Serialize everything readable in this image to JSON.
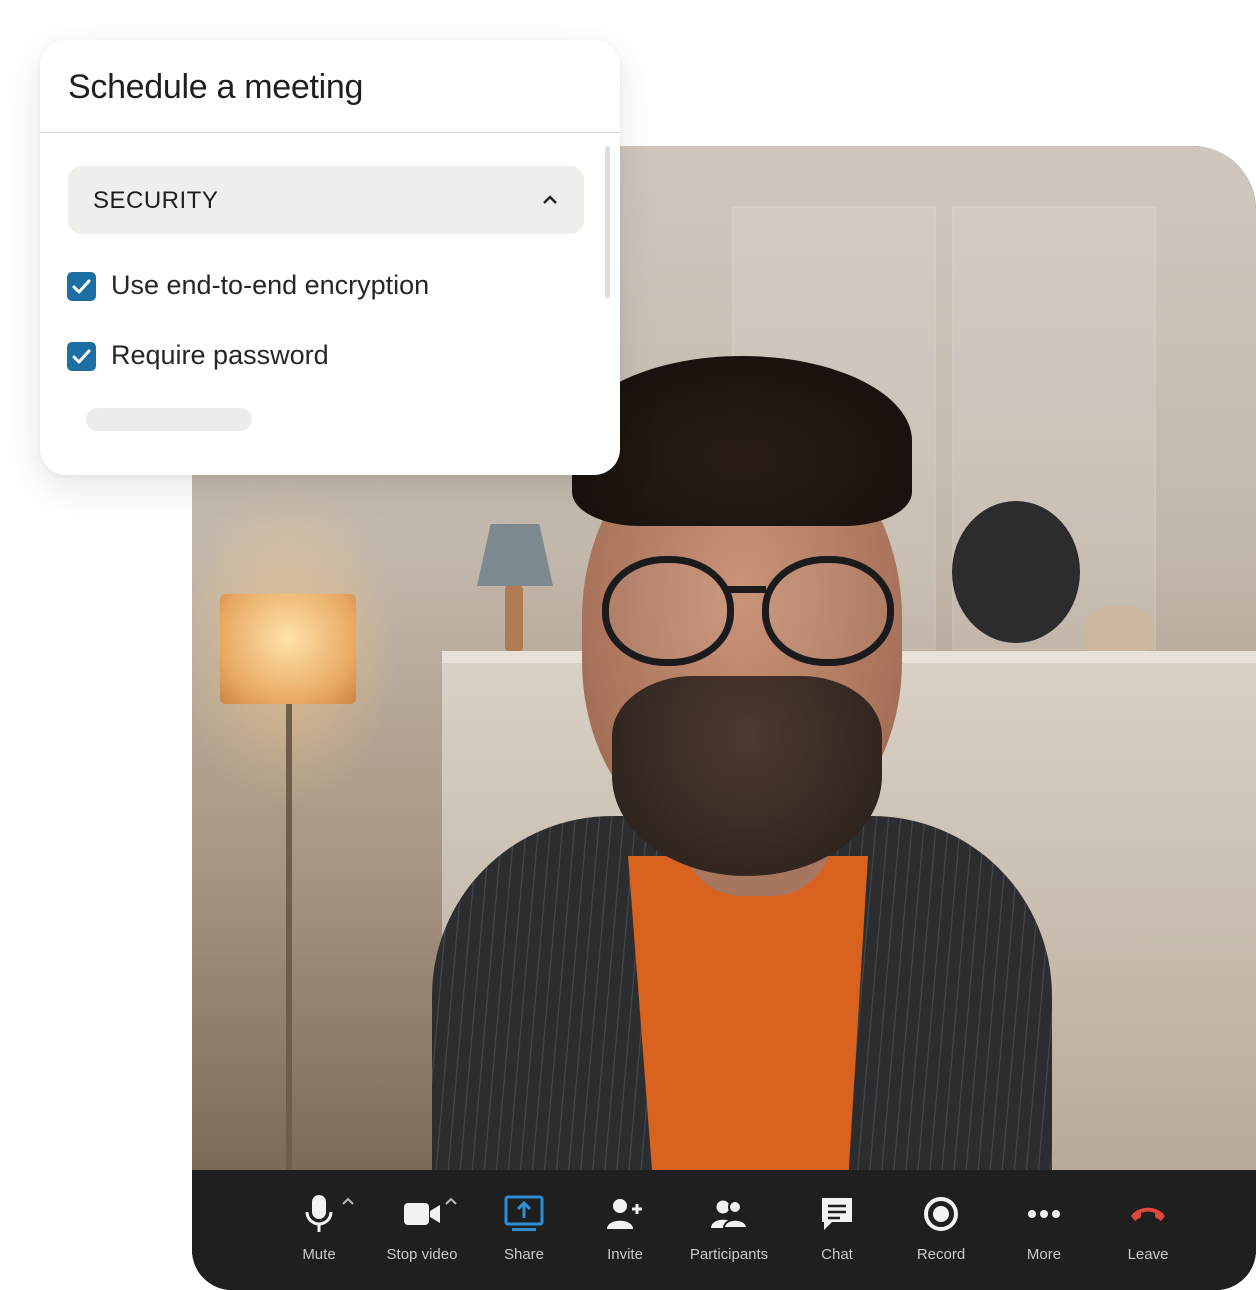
{
  "schedule_dialog": {
    "title": "Schedule a meeting",
    "section": {
      "title": "SECURITY",
      "expanded": true,
      "options": [
        {
          "label": "Use end-to-end encryption",
          "checked": true
        },
        {
          "label": "Require password",
          "checked": true
        }
      ]
    }
  },
  "toolbar": {
    "items": [
      {
        "id": "mute",
        "label": "Mute",
        "icon": "microphone-icon",
        "has_menu": true
      },
      {
        "id": "stop-video",
        "label": "Stop video",
        "icon": "video-camera-icon",
        "has_menu": true
      },
      {
        "id": "share",
        "label": "Share",
        "icon": "share-screen-icon",
        "active": true
      },
      {
        "id": "invite",
        "label": "Invite",
        "icon": "add-person-icon"
      },
      {
        "id": "participants",
        "label": "Participants",
        "icon": "participants-icon"
      },
      {
        "id": "chat",
        "label": "Chat",
        "icon": "chat-icon"
      },
      {
        "id": "record",
        "label": "Record",
        "icon": "record-icon"
      },
      {
        "id": "more",
        "label": "More",
        "icon": "more-dots-icon"
      },
      {
        "id": "leave",
        "label": "Leave",
        "icon": "hang-up-icon"
      }
    ]
  },
  "colors": {
    "checkbox": "#1d6fa3",
    "share_active": "#2e8fd6",
    "leave_red": "#e0463e",
    "toolbar_bg": "#1f1f20",
    "sweater": "#d9631e"
  }
}
